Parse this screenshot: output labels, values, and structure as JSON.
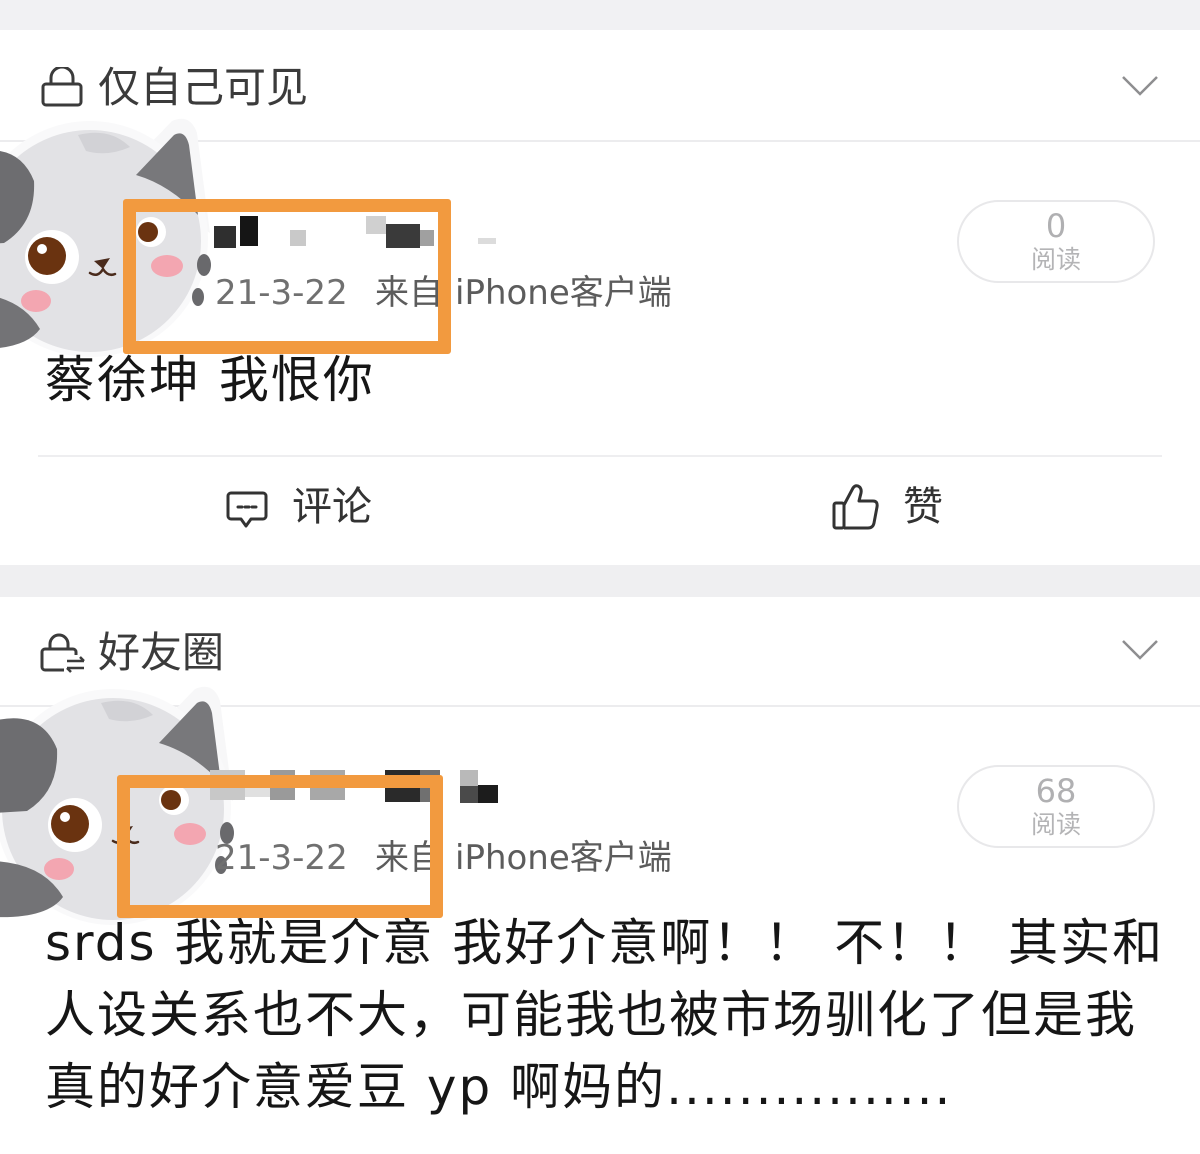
{
  "colors": {
    "highlight": "#f29a3f",
    "page_background": "#efeff1",
    "card_background": "#ffffff"
  },
  "icons": {
    "private": "lock-icon",
    "friends": "friends-circle-icon",
    "expand": "chevron-down-icon",
    "comment": "comment-icon",
    "like": "thumbs-up-icon"
  },
  "posts": [
    {
      "visibility": "仅自己可见",
      "date": "21-3-22",
      "source_prefix": "来自",
      "source_name": "iPhone客户端",
      "read_count": "0",
      "read_label": "阅读",
      "text_lines": [
        "蔡徐坤 我恨你"
      ],
      "actions": {
        "comment_label": "评论",
        "like_label": "赞"
      }
    },
    {
      "visibility": "好友圈",
      "date": "21-3-22",
      "source_prefix": "来自",
      "source_name": "iPhone客户端",
      "read_count": "68",
      "read_label": "阅读",
      "text_lines": [
        "srds 我就是介意 我好介意啊！！ 不！！ 其实和",
        "人设关系也不大，可能我也被市场驯化了但是我",
        "真的好介意爱豆 yp 啊妈的................"
      ]
    }
  ]
}
